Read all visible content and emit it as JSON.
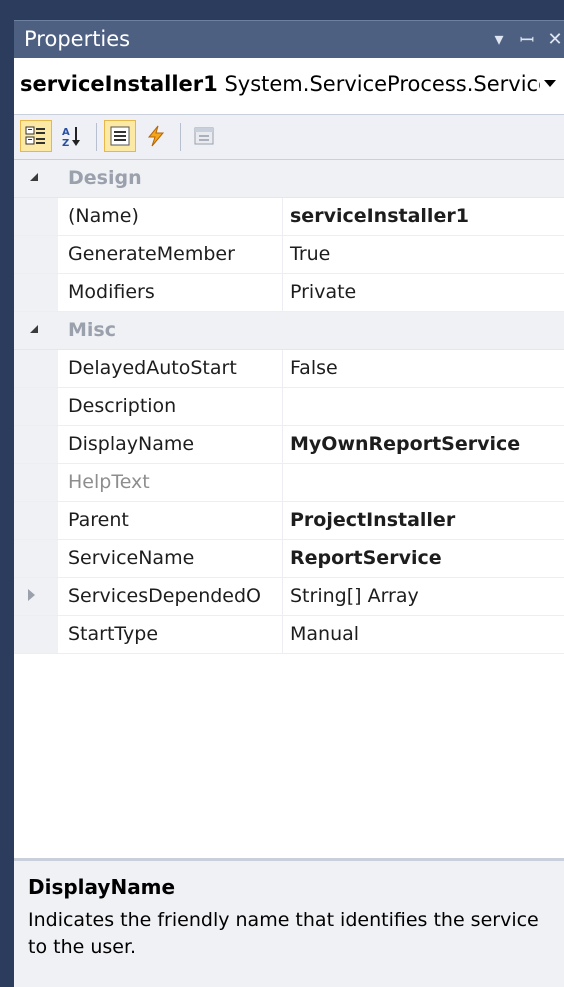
{
  "window": {
    "title": "Properties"
  },
  "object_selector": {
    "name": "serviceInstaller1",
    "type": "System.ServiceProcess.Service"
  },
  "toolbar": {
    "buttons": [
      {
        "icon": "categorized-icon",
        "active": true
      },
      {
        "icon": "alphabetical-icon",
        "active": false
      },
      {
        "icon": "properties-icon",
        "active": true
      },
      {
        "icon": "events-icon",
        "active": false
      },
      {
        "icon": "property-pages-icon",
        "active": false
      }
    ]
  },
  "categories": [
    {
      "label": "Design",
      "rows": [
        {
          "name": "(Name)",
          "value": "serviceInstaller1",
          "bold": true
        },
        {
          "name": "GenerateMember",
          "value": "True",
          "bold": false
        },
        {
          "name": "Modifiers",
          "value": "Private",
          "bold": false
        }
      ]
    },
    {
      "label": "Misc",
      "rows": [
        {
          "name": "DelayedAutoStart",
          "value": "False",
          "bold": false
        },
        {
          "name": "Description",
          "value": "",
          "bold": false
        },
        {
          "name": "DisplayName",
          "value": "MyOwnReportService",
          "bold": true
        },
        {
          "name": "HelpText",
          "value": "",
          "bold": false,
          "disabled": true
        },
        {
          "name": "Parent",
          "value": "ProjectInstaller",
          "bold": true
        },
        {
          "name": "ServiceName",
          "value": "ReportService",
          "bold": true
        },
        {
          "name": "ServicesDependedO",
          "value": "String[] Array",
          "bold": false,
          "expandable": true
        },
        {
          "name": "StartType",
          "value": "Manual",
          "bold": false
        }
      ]
    }
  ],
  "description": {
    "title": "DisplayName",
    "text": "Indicates the friendly name that identifies the service to the user."
  }
}
